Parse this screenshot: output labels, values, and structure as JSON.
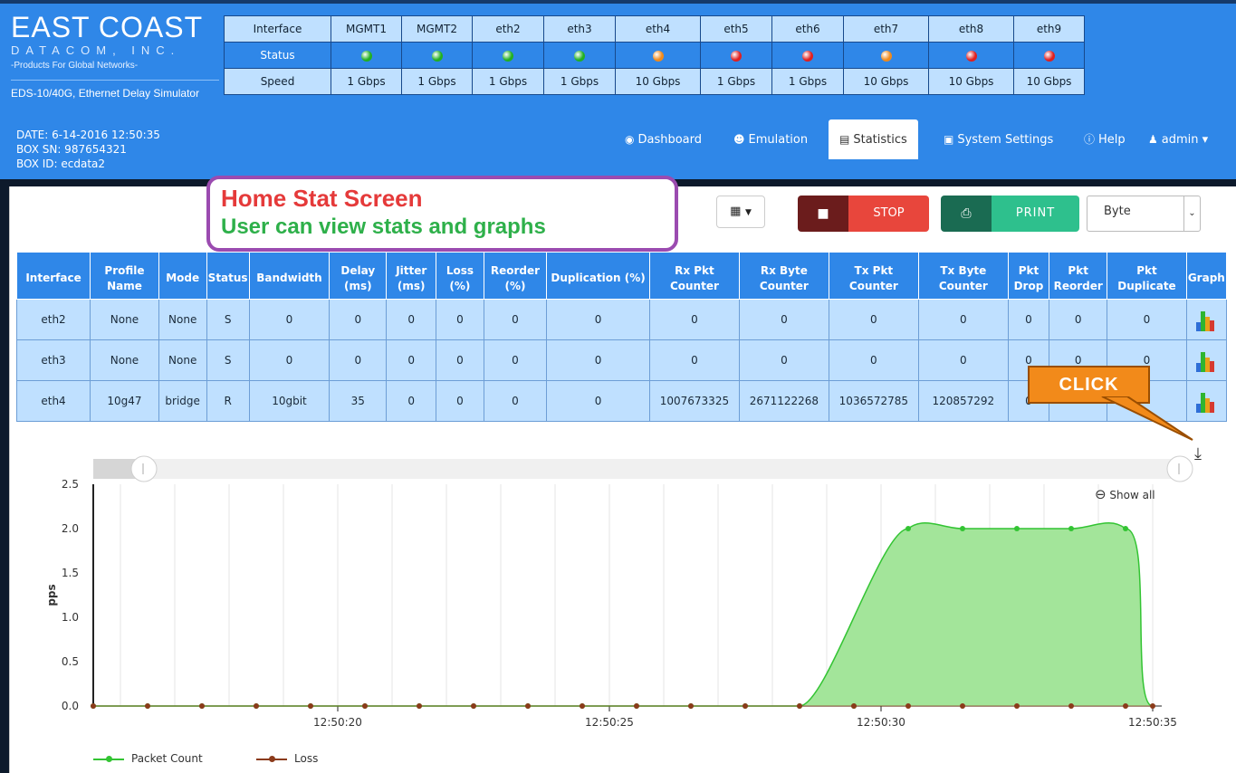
{
  "logo": {
    "line1": "EAST COAST",
    "line2": "DATACOM, INC.",
    "line3": "-Products For Global Networks-",
    "line4": "EDS-10/40G, Ethernet Delay Simulator"
  },
  "interfaces": {
    "row_labels": [
      "Interface",
      "Status",
      "Speed"
    ],
    "items": [
      {
        "name": "MGMT1",
        "status_color": "#22b022",
        "speed": "1 Gbps"
      },
      {
        "name": "MGMT2",
        "status_color": "#22b022",
        "speed": "1 Gbps"
      },
      {
        "name": "eth2",
        "status_color": "#22b022",
        "speed": "1 Gbps"
      },
      {
        "name": "eth3",
        "status_color": "#22b022",
        "speed": "1 Gbps"
      },
      {
        "name": "eth4",
        "status_color": "#f08a1c",
        "speed": "10 Gbps"
      },
      {
        "name": "eth5",
        "status_color": "#e02020",
        "speed": "1 Gbps"
      },
      {
        "name": "eth6",
        "status_color": "#e02020",
        "speed": "1 Gbps"
      },
      {
        "name": "eth7",
        "status_color": "#f08a1c",
        "speed": "10 Gbps"
      },
      {
        "name": "eth8",
        "status_color": "#e02020",
        "speed": "10 Gbps"
      },
      {
        "name": "eth9",
        "status_color": "#e02020",
        "speed": "10 Gbps"
      }
    ]
  },
  "box_info": {
    "date": "DATE: 6-14-2016 12:50:35",
    "serial": "BOX SN: 987654321",
    "id": "BOX ID: ecdata2"
  },
  "nav": {
    "dashboard": "Dashboard",
    "emulation": "Emulation",
    "statistics": "Statistics",
    "system_settings": "System Settings",
    "help": "Help",
    "user": "admin"
  },
  "callout": {
    "title": "Home Stat Screen",
    "subtitle": "User can view stats and graphs"
  },
  "toolbar": {
    "columns_icon": "columns-icon",
    "stop_label": "STOP",
    "print_label": "PRINT",
    "unit_value": "Byte"
  },
  "stats": {
    "headers": [
      "Interface",
      "Profile Name",
      "Mode",
      "Status",
      "Bandwidth",
      "Delay (ms)",
      "Jitter (ms)",
      "Loss (%)",
      "Reorder (%)",
      "Duplication (%)",
      "Rx Pkt Counter",
      "Rx Byte Counter",
      "Tx Pkt Counter",
      "Tx Byte Counter",
      "Pkt Drop",
      "Pkt Reorder",
      "Pkt Duplicate",
      "Graph"
    ],
    "rows": [
      [
        "eth2",
        "None",
        "None",
        "S",
        "0",
        "0",
        "0",
        "0",
        "0",
        "0",
        "0",
        "0",
        "0",
        "0",
        "0",
        "0",
        "0"
      ],
      [
        "eth3",
        "None",
        "None",
        "S",
        "0",
        "0",
        "0",
        "0",
        "0",
        "0",
        "0",
        "0",
        "0",
        "0",
        "0",
        "0",
        "0"
      ],
      [
        "eth4",
        "10g47",
        "bridge",
        "R",
        "10gbit",
        "35",
        "0",
        "0",
        "0",
        "0",
        "1007673325",
        "2671122268",
        "1036572785",
        "120857292",
        "0",
        "",
        ""
      ]
    ]
  },
  "click_callout": "CLICK",
  "chart_controls": {
    "show_all": "Show all",
    "download_icon": "download-icon",
    "zoom_icon": "zoom-out-icon"
  },
  "chart_data": {
    "type": "area",
    "ylabel": "pps",
    "ylim": [
      0,
      2.5
    ],
    "yticks": [
      "0.0",
      "0.5",
      "1.0",
      "1.5",
      "2.0",
      "2.5"
    ],
    "x_tick_labels": [
      "12:50:20",
      "12:50:25",
      "12:50:30",
      "12:50:35"
    ],
    "x_start_seconds": 15.5,
    "x_end_seconds": 35,
    "series": [
      {
        "name": "Packet Count",
        "color": "#33c433",
        "fill": "#a3e59a",
        "x": [
          15.5,
          16.5,
          17.5,
          18.5,
          19.5,
          20.5,
          21.5,
          22.5,
          23.5,
          24.5,
          25.5,
          26.5,
          27.5,
          28.5,
          29.5,
          30.5,
          31.5,
          32.5,
          33.5,
          34.5
        ],
        "values": [
          0,
          0,
          0,
          0,
          0,
          0,
          0,
          0,
          0,
          0,
          0,
          0,
          0,
          0,
          0,
          2,
          2,
          2,
          2,
          2
        ]
      },
      {
        "name": "Loss",
        "color": "#8b3a1a",
        "x": [
          15.5,
          16.5,
          17.5,
          18.5,
          19.5,
          20.5,
          21.5,
          22.5,
          23.5,
          24.5,
          25.5,
          26.5,
          27.5,
          28.5,
          29.5,
          30.5,
          31.5,
          32.5,
          33.5,
          34.5,
          35
        ],
        "values": [
          0,
          0,
          0,
          0,
          0,
          0,
          0,
          0,
          0,
          0,
          0,
          0,
          0,
          0,
          0,
          0,
          0,
          0,
          0,
          0,
          0
        ]
      }
    ],
    "legend": "bottom-left",
    "grid": "vertical"
  }
}
